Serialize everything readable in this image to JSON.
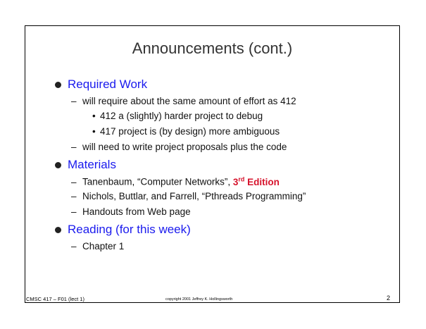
{
  "slide": {
    "title": "Announcements (cont.)",
    "sections": [
      {
        "heading": "Required Work",
        "items": [
          {
            "text": "will require about the same amount of effort as 412",
            "subitems": [
              "412 a (slightly) harder project to debug",
              "417 project is (by design) more ambiguous"
            ]
          },
          {
            "text": "will need to write project proposals plus the code"
          }
        ]
      },
      {
        "heading": "Materials",
        "items": [
          {
            "text_before": "Tanenbaum, “Computer Networks”, ",
            "edition_num": "3",
            "edition_sup": "rd",
            "edition_word": " Edition"
          },
          {
            "text": "Nichols, Buttlar, and Farrell, “Pthreads Programming”"
          },
          {
            "text": "Handouts from Web page"
          }
        ]
      },
      {
        "heading": "Reading (for this week)",
        "items": [
          {
            "text": "Chapter 1"
          }
        ]
      }
    ],
    "footer": {
      "course": "CMSC 417 – F01  (lect 1)",
      "copyright": "copyright 2001 Jeffrey K. Hollingsworth",
      "page": "2"
    }
  },
  "colors": {
    "heading": "#1a1aee",
    "highlight": "#d6122b"
  }
}
